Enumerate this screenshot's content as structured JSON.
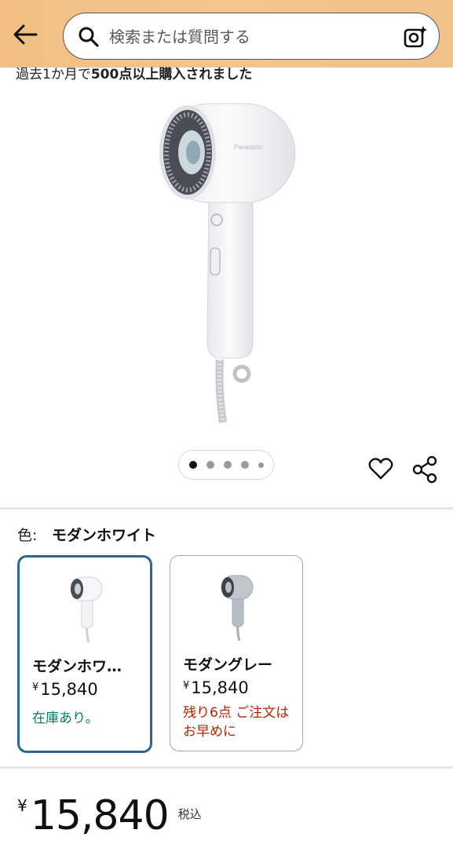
{
  "header": {
    "search_placeholder": "検索または質問する",
    "icons": {
      "back": "arrow-left-icon",
      "search": "search-icon",
      "camera": "camera-search-icon"
    },
    "colors": {
      "bar": "#f3bf83"
    }
  },
  "product": {
    "purchase_note_prefix": "過去1か月で",
    "purchase_note_bold": "500点以上購入されました",
    "image_brand": "Panasonic",
    "carousel": {
      "count": 5,
      "active": 1
    }
  },
  "variants": {
    "label": "色:",
    "selected_name": "モダンホワイト",
    "items": [
      {
        "name": "モダンホワ…",
        "currency": "¥",
        "price": "15,840",
        "stock": "在庫あり。",
        "selected": true
      },
      {
        "name": "モダングレー",
        "currency": "¥",
        "price": "15,840",
        "stock": "残り6点 ご注文はお早めに",
        "selected": false
      }
    ],
    "colors": {
      "selected_border": "#2c6495",
      "in_stock": "#067d62",
      "low_stock": "#b12704"
    }
  },
  "price": {
    "currency": "¥",
    "amount": "15,840",
    "tax_note": "税込"
  }
}
